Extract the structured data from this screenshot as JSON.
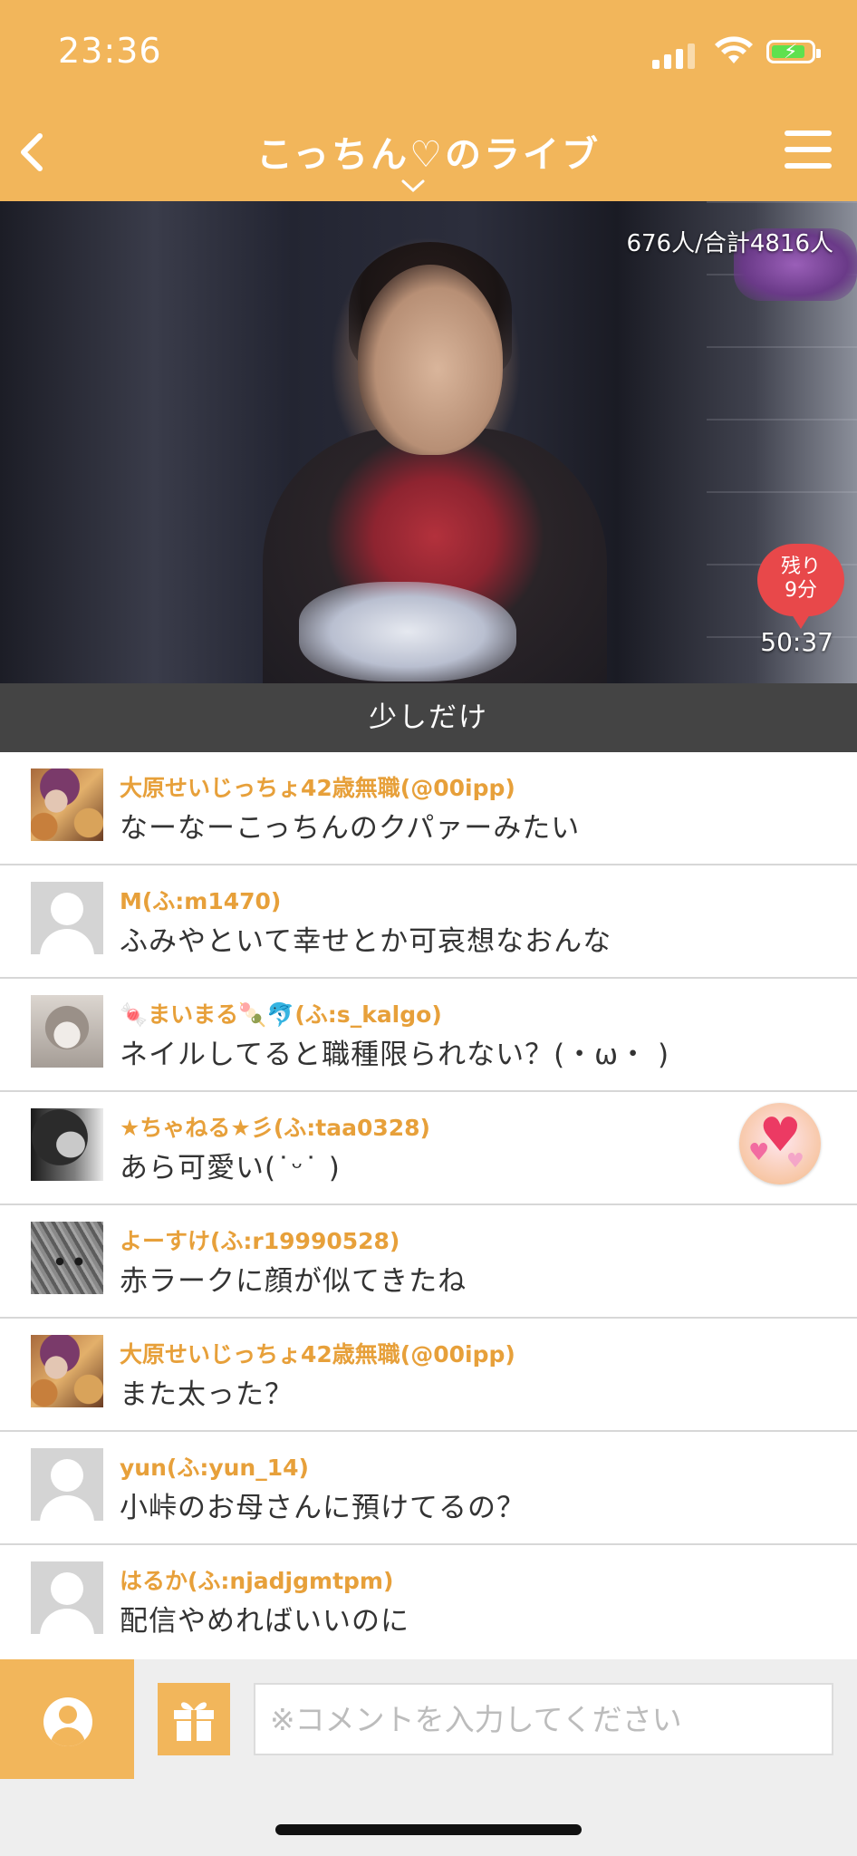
{
  "status_bar": {
    "time": "23:36"
  },
  "header": {
    "title": "こっちん♡のライブ"
  },
  "video": {
    "viewer_count": "676人/合計4816人",
    "remaining_badge": "残り\n9分",
    "timer": "50:37"
  },
  "live_title": "少しだけ",
  "comments": [
    {
      "name": "大原せいじっちょ42歳無職(@00ipp)",
      "text": "なーなーこっちんのクパァーみたい",
      "avatar": "photo"
    },
    {
      "name": "M(ふ:m1470)",
      "text": "ふみやといて幸せとか可哀想なおんな",
      "avatar": "default-avatar"
    },
    {
      "name": "🍬まいまる🍡🐬(ふ:s_kalgo)",
      "text": "ネイルしてると職種限られない？(・ω・ )",
      "avatar": "photo"
    },
    {
      "name": "★ちゃねる★彡(ふ:taa0328)",
      "text": "あら可愛い(˙ᵕ˙ )",
      "avatar": "photo",
      "badge": "heart-gift-icon"
    },
    {
      "name": "よーすけ(ふ:r19990528)",
      "text": "赤ラークに顔が似てきたね",
      "avatar": "photo"
    },
    {
      "name": "大原せいじっちょ42歳無職(@00ipp)",
      "text": "また太った？",
      "avatar": "photo"
    },
    {
      "name": "yun(ふ:yun_14)",
      "text": "小峠のお母さんに預けてるの？",
      "avatar": "default-avatar"
    },
    {
      "name": "はるか(ふ:njadjgmtpm)",
      "text": "配信やめればいいのに",
      "avatar": "default-avatar"
    }
  ],
  "input": {
    "placeholder": "※コメントを入力してください"
  },
  "colors": {
    "accent": "#f2b65b",
    "name_text": "#e7a03a",
    "live_bar": "#444444",
    "badge": "#e8484a"
  }
}
